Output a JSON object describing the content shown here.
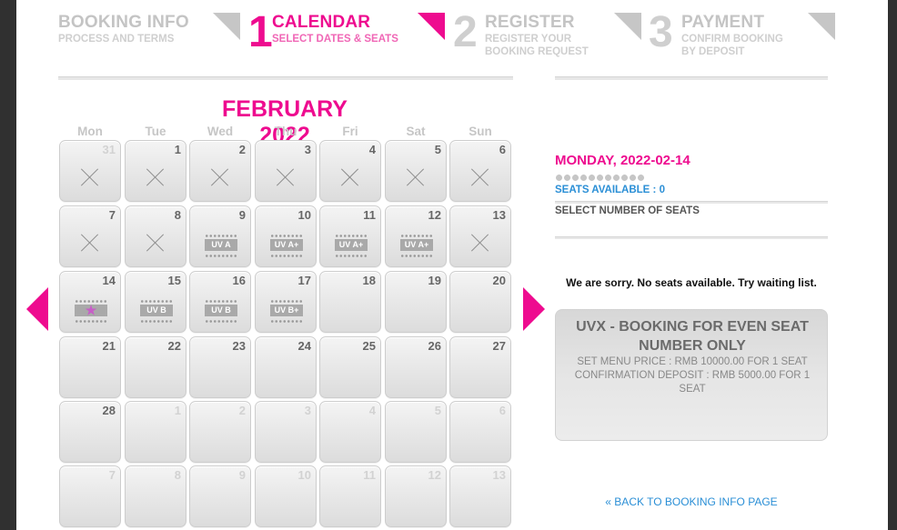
{
  "steps": [
    {
      "number": "",
      "title": "BOOKING INFO",
      "subtitle": "PROCESS AND TERMS",
      "active": false
    },
    {
      "number": "1",
      "title": "CALENDAR",
      "subtitle": "SELECT DATES & SEATS",
      "active": true
    },
    {
      "number": "2",
      "title": "REGISTER",
      "subtitle": "REGISTER YOUR\nBOOKING REQUEST",
      "active": false
    },
    {
      "number": "3",
      "title": "PAYMENT",
      "subtitle": "CONFIRM BOOKING\nBY DEPOSIT",
      "active": false
    }
  ],
  "calendar": {
    "month_title": "FEBRUARY 2022",
    "weekdays": [
      "Mon",
      "Tue",
      "Wed",
      "Thu",
      "Fri",
      "Sat",
      "Sun"
    ],
    "weeks": [
      [
        {
          "day": "31",
          "other": true,
          "status": "closed"
        },
        {
          "day": "1",
          "status": "closed"
        },
        {
          "day": "2",
          "status": "closed"
        },
        {
          "day": "3",
          "status": "closed"
        },
        {
          "day": "4",
          "status": "closed"
        },
        {
          "day": "5",
          "status": "closed"
        },
        {
          "day": "6",
          "status": "closed"
        }
      ],
      [
        {
          "day": "7",
          "status": "closed"
        },
        {
          "day": "8",
          "status": "closed"
        },
        {
          "day": "9",
          "tag": "UV A"
        },
        {
          "day": "10",
          "tag": "UV A+"
        },
        {
          "day": "11",
          "tag": "UV A+"
        },
        {
          "day": "12",
          "tag": "UV A+"
        },
        {
          "day": "13",
          "status": "closed"
        }
      ],
      [
        {
          "day": "14",
          "tag": "star",
          "selected": true
        },
        {
          "day": "15",
          "tag": "UV B"
        },
        {
          "day": "16",
          "tag": "UV B"
        },
        {
          "day": "17",
          "tag": "UV B+"
        },
        {
          "day": "18"
        },
        {
          "day": "19"
        },
        {
          "day": "20"
        }
      ],
      [
        {
          "day": "21"
        },
        {
          "day": "22"
        },
        {
          "day": "23"
        },
        {
          "day": "24"
        },
        {
          "day": "25"
        },
        {
          "day": "26"
        },
        {
          "day": "27"
        }
      ],
      [
        {
          "day": "28"
        },
        {
          "day": "1",
          "other": true
        },
        {
          "day": "2",
          "other": true
        },
        {
          "day": "3",
          "other": true
        },
        {
          "day": "4",
          "other": true
        },
        {
          "day": "5",
          "other": true
        },
        {
          "day": "6",
          "other": true
        }
      ],
      [
        {
          "day": "7",
          "other": true
        },
        {
          "day": "8",
          "other": true
        },
        {
          "day": "9",
          "other": true
        },
        {
          "day": "10",
          "other": true
        },
        {
          "day": "11",
          "other": true
        },
        {
          "day": "12",
          "other": true
        },
        {
          "day": "13",
          "other": true
        }
      ]
    ]
  },
  "panel": {
    "selected_date": "MONDAY, 2022-02-14",
    "seats_available": "SEATS AVAILABLE : 0",
    "select_seats_label": "SELECT NUMBER OF SEATS",
    "sorry_message": "We are sorry. No seats available. Try waiting list.",
    "info_title": "UVX - BOOKING FOR EVEN SEAT NUMBER ONLY",
    "info_price": "SET MENU PRICE : RMB 10000.00 FOR 1 SEAT",
    "info_deposit": "CONFIRMATION DEPOSIT : RMB 5000.00 FOR 1 SEAT",
    "back_link": "« BACK TO BOOKING INFO PAGE"
  },
  "colors": {
    "accent": "#ee0b8f",
    "link": "#2b8fd6",
    "muted": "#c6c6c6"
  }
}
